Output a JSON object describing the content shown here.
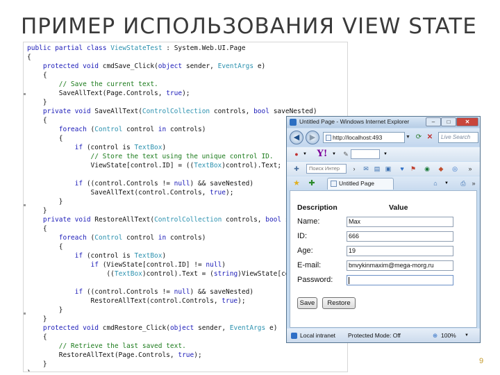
{
  "slide": {
    "title": "ПРИМЕР ИСПОЛЬЗОВАНИЯ VIEW STATE",
    "page_number": "9"
  },
  "code": {
    "lines": [
      "public partial class ViewStateTest : System.Web.UI.Page",
      "{",
      "    protected void cmdSave_Click(object sender, EventArgs e)",
      "    {",
      "        // Save the current text.",
      "        SaveAllText(Page.Controls, true);",
      "    }",
      "    private void SaveAllText(ControlCollection controls, bool saveNested)",
      "    {",
      "        foreach (Control control in controls)",
      "        {",
      "            if (control is TextBox)",
      "                // Store the text using the unique control ID.",
      "                ViewState[control.ID] = ((TextBox)control).Text;",
      "",
      "            if ((control.Controls != null) && saveNested)",
      "                SaveAllText(control.Controls, true);",
      "        }",
      "    }",
      "    private void RestoreAllText(ControlCollection controls, bool saveNested)",
      "    {",
      "        foreach (Control control in controls)",
      "        {",
      "            if (control is TextBox)",
      "                if (ViewState[control.ID] != null)",
      "                    ((TextBox)control).Text = (string)ViewState[control.ID];",
      "",
      "            if ((control.Controls != null) && saveNested)",
      "                RestoreAllText(control.Controls, true);",
      "        }",
      "    }",
      "    protected void cmdRestore_Click(object sender, EventArgs e)",
      "    {",
      "        // Retrieve the last saved text.",
      "        RestoreAllText(Page.Controls, true);",
      "    }",
      "}"
    ]
  },
  "browser": {
    "window_title": "Untitled Page - Windows Internet Explorer",
    "address": "http://localhost:493",
    "search_placeholder": "Live Search",
    "links_search_placeholder": "Поиск Интер",
    "tab_label": "Untitled Page",
    "status_zone": "Local intranet",
    "status_protected": "Protected Mode: Off",
    "zoom": "100%",
    "icons": [
      "back-icon",
      "forward-icon",
      "refresh-icon",
      "stop-icon",
      "yahoo-icon",
      "star-icon",
      "home-icon",
      "globe-icon"
    ]
  },
  "form": {
    "header_description": "Description",
    "header_value": "Value",
    "fields": [
      {
        "label": "Name:",
        "value": "Max"
      },
      {
        "label": "ID:",
        "value": "666"
      },
      {
        "label": "Age:",
        "value": "19"
      },
      {
        "label": "E-mail:",
        "value": "bnvykinmaxim@mega-morg.ru"
      },
      {
        "label": "Password:",
        "value": ""
      }
    ],
    "save_label": "Save",
    "restore_label": "Restore"
  },
  "colors": {
    "keyword": "#1a1ab8",
    "type": "#2b91af",
    "comment": "#1a7a1a",
    "title": "#3a3a3a",
    "page_number": "#c59a2c"
  }
}
